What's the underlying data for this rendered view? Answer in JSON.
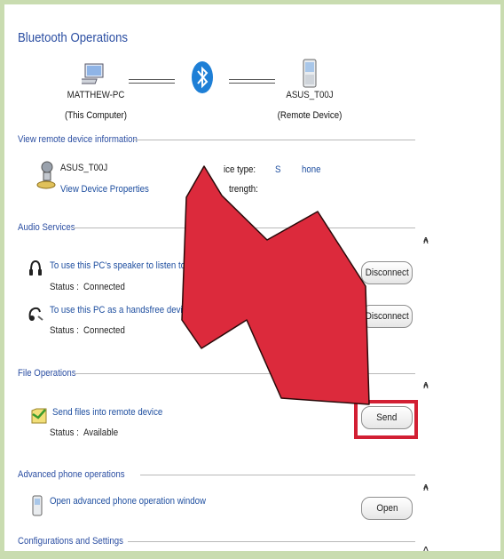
{
  "title": "Bluetooth Operations",
  "computer": {
    "name": "MATTHEW-PC",
    "role": "(This Computer)",
    "icon": "computer-icon"
  },
  "remote": {
    "name": "ASUS_T00J",
    "role": "(Remote Device)",
    "icon": "phone-icon"
  },
  "bluetooth_icon": "bluetooth-icon",
  "device_info": {
    "section": "View remote device information",
    "device_name": "ASUS_T00J",
    "properties_link": "View Device Properties",
    "type_label": "ice type:",
    "type_value_a": "S",
    "type_value_b": "hone",
    "strength_label": "trength:"
  },
  "audio": {
    "section": "Audio Services",
    "items": [
      {
        "text": "To use this PC's speaker to listen to Stereo Audio pla",
        "status_label": "Status :",
        "status": "Connected",
        "button": "Disconnect",
        "icon": "headphones-icon"
      },
      {
        "text": "To use this PC as a handsfree device",
        "status_label": "Status :",
        "status": "Connected",
        "button": "Disconnect",
        "icon": "handsfree-icon"
      }
    ]
  },
  "file_ops": {
    "section": "File Operations",
    "text": "Send files into remote device",
    "status_label": "Status :",
    "status": "Available",
    "button": "Send",
    "icon": "send-files-icon"
  },
  "advanced": {
    "section": "Advanced phone operations",
    "text": "Open advanced phone operation window",
    "button": "Open",
    "icon": "phone-small-icon"
  },
  "config": {
    "section": "Configurations and Settings"
  },
  "colors": {
    "accent": "#2b4ea2",
    "arrow": "#dc2a3c",
    "highlight": "#d21f33",
    "frame": "#c9dcb0"
  }
}
